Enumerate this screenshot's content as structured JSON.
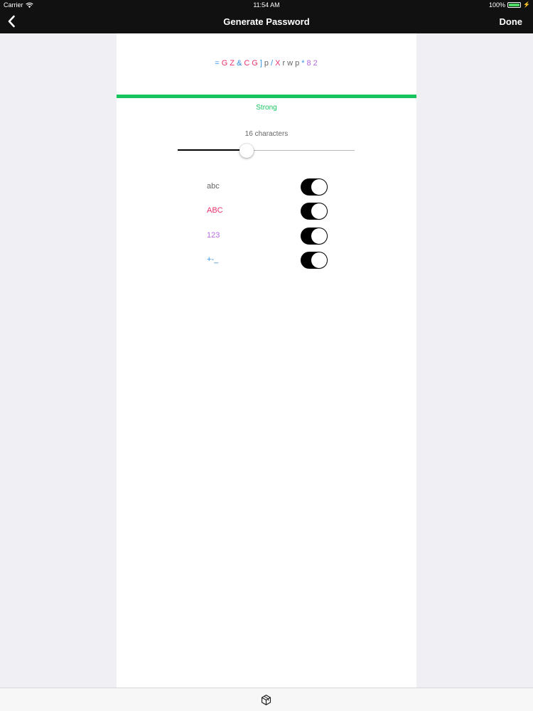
{
  "status_bar": {
    "carrier": "Carrier",
    "time": "11:54 AM",
    "battery": "100%",
    "icons": [
      "wifi-icon",
      "battery-icon",
      "charging-icon"
    ]
  },
  "nav": {
    "back_icon": "chevron-left-icon",
    "title": "Generate Password",
    "done_label": "Done"
  },
  "password": {
    "characters": [
      {
        "char": "=",
        "type": "symbol"
      },
      {
        "char": "G",
        "type": "upper"
      },
      {
        "char": "Z",
        "type": "upper"
      },
      {
        "char": "&",
        "type": "symbol"
      },
      {
        "char": "C",
        "type": "upper"
      },
      {
        "char": "G",
        "type": "upper"
      },
      {
        "char": "]",
        "type": "symbol"
      },
      {
        "char": "p",
        "type": "lower"
      },
      {
        "char": "/",
        "type": "symbol"
      },
      {
        "char": "X",
        "type": "upper"
      },
      {
        "char": "r",
        "type": "lower"
      },
      {
        "char": "w",
        "type": "lower"
      },
      {
        "char": "p",
        "type": "lower"
      },
      {
        "char": "*",
        "type": "symbol"
      },
      {
        "char": "8",
        "type": "digit"
      },
      {
        "char": "2",
        "type": "digit"
      }
    ]
  },
  "strength": {
    "label": "Strong",
    "color": "#16c55e"
  },
  "length": {
    "label": "16 characters",
    "slider_fraction": 0.39
  },
  "options": [
    {
      "label": "abc",
      "type": "lower",
      "enabled": true
    },
    {
      "label": "ABC",
      "type": "upper",
      "enabled": true
    },
    {
      "label": "123",
      "type": "digit",
      "enabled": true
    },
    {
      "label": "+-_",
      "type": "symbol",
      "enabled": true
    }
  ],
  "colors": {
    "lower": "#666666",
    "upper": "#e8336b",
    "digit": "#b469de",
    "symbol": "#2f8fe8",
    "toggle_on": "#000000",
    "nav_background": "#111111"
  },
  "toolbar": {
    "icon": "cube-icon"
  }
}
